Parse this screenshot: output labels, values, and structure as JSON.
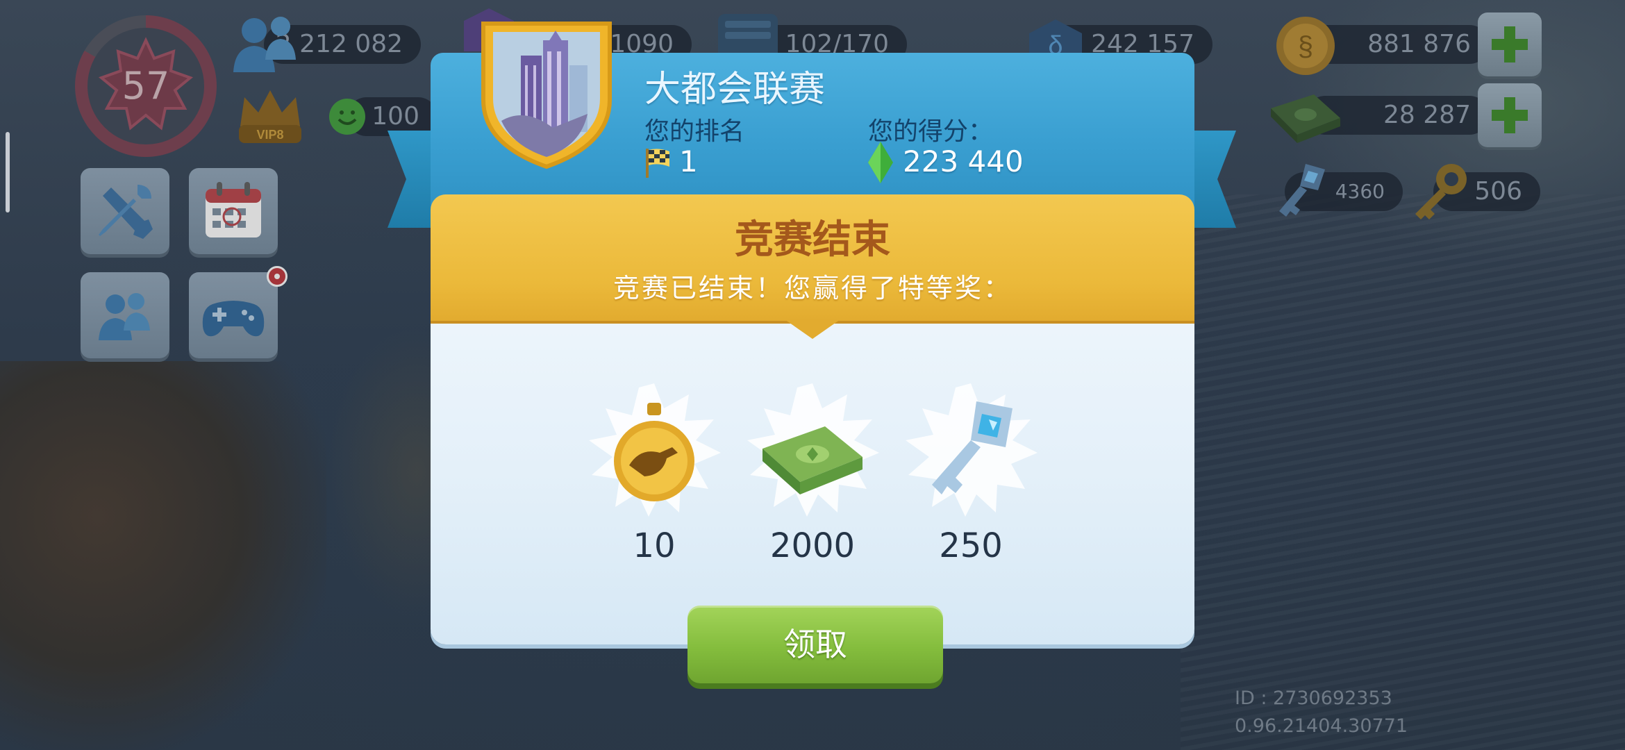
{
  "hud": {
    "level": "57",
    "population": "2 212 082",
    "happiness": "100",
    "vip": "VIP8",
    "gold_value": "1090",
    "storage": "102/170",
    "neosimoleons": "242 157",
    "simoleons": "881 876",
    "simcash": "28 287",
    "blue_keys": "4360",
    "golden_keys": "506"
  },
  "dialog": {
    "title": "大都会联赛",
    "rank_label": "您的排名",
    "rank_value": "1",
    "score_label": "您的得分：",
    "score_value": "223 440",
    "banner_title": "竞赛结束",
    "banner_subtitle": "竞赛已结束！您赢得了特等奖：",
    "rewards": [
      {
        "icon": "speedup-token-icon",
        "amount": "10"
      },
      {
        "icon": "simcash-icon",
        "amount": "2000"
      },
      {
        "icon": "platinum-key-icon",
        "amount": "250"
      }
    ],
    "claim_label": "领取"
  },
  "footer": {
    "id": "ID : 2730692353",
    "version": "0.96.21404.30771"
  },
  "colors": {
    "header_blue": "#3a9fd1",
    "banner_gold": "#ebb93a",
    "claim_green": "#84bd3d",
    "title_orange": "#a4581c"
  }
}
